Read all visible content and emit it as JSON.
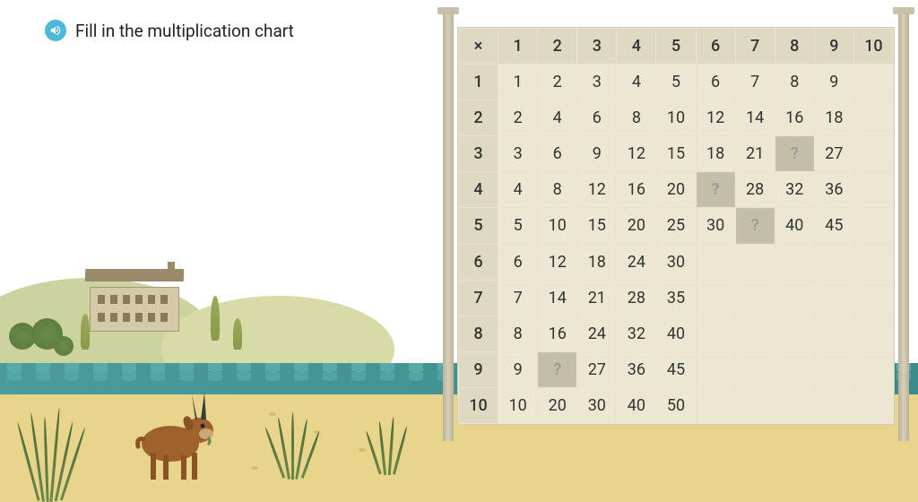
{
  "prompt": "Fill in the multiplication chart",
  "audio_icon": "speaker",
  "chart_data": {
    "type": "table",
    "title": "Multiplication chart",
    "rows": 10,
    "cols": 10,
    "header_symbol": "×",
    "col_headers": [
      "1",
      "2",
      "3",
      "4",
      "5",
      "6",
      "7",
      "8",
      "9",
      "10"
    ],
    "row_headers": [
      "1",
      "2",
      "3",
      "4",
      "5",
      "6",
      "7",
      "8",
      "9",
      "10"
    ],
    "cells": [
      [
        "1",
        "2",
        "3",
        "4",
        "5",
        "6",
        "7",
        "8",
        "9",
        ""
      ],
      [
        "2",
        "4",
        "6",
        "8",
        "10",
        "12",
        "14",
        "16",
        "18",
        ""
      ],
      [
        "3",
        "6",
        "9",
        "12",
        "15",
        "18",
        "21",
        "?",
        "27",
        ""
      ],
      [
        "4",
        "8",
        "12",
        "16",
        "20",
        "?",
        "28",
        "32",
        "36",
        ""
      ],
      [
        "5",
        "10",
        "15",
        "20",
        "25",
        "30",
        "?",
        "40",
        "45",
        ""
      ],
      [
        "6",
        "12",
        "18",
        "24",
        "30",
        "",
        "",
        "",
        "",
        ""
      ],
      [
        "7",
        "14",
        "21",
        "28",
        "35",
        "",
        "",
        "",
        "",
        ""
      ],
      [
        "8",
        "16",
        "24",
        "32",
        "40",
        "",
        "",
        "",
        "",
        ""
      ],
      [
        "9",
        "?",
        "27",
        "36",
        "45",
        "",
        "",
        "",
        "",
        ""
      ],
      [
        "10",
        "20",
        "30",
        "40",
        "50",
        "",
        "",
        "",
        "",
        ""
      ]
    ],
    "blanks": [
      [
        3,
        8
      ],
      [
        4,
        6
      ],
      [
        5,
        7
      ],
      [
        9,
        2
      ]
    ]
  }
}
